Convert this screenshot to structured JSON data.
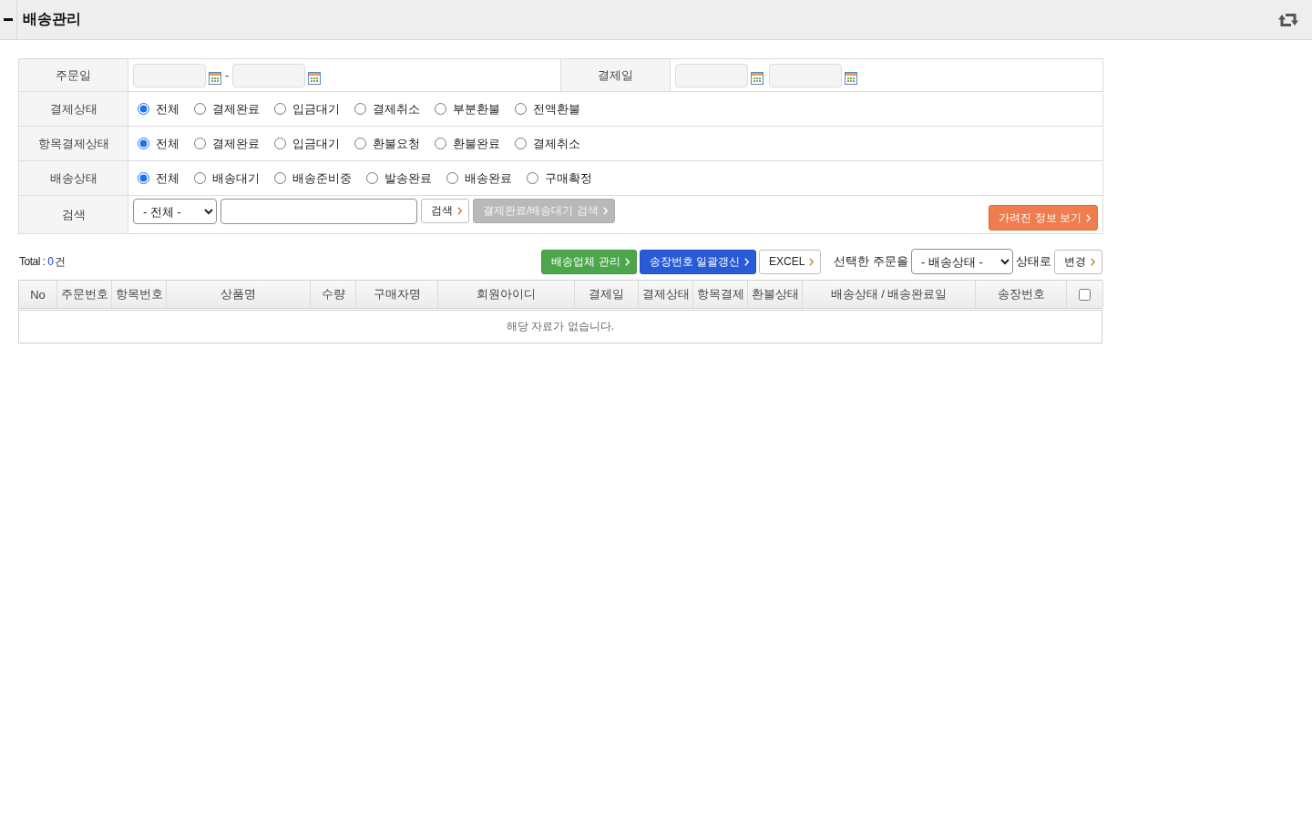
{
  "header": {
    "title": "배송관리"
  },
  "filters": {
    "order_date": {
      "label": "주문일",
      "separator": "-"
    },
    "payment_date": {
      "label": "결제일"
    },
    "radio_groups": [
      {
        "label": "결제상태",
        "options": [
          {
            "label": "전체",
            "selected": true
          },
          {
            "label": "결제완료",
            "selected": false
          },
          {
            "label": "입금대기",
            "selected": false
          },
          {
            "label": "결제취소",
            "selected": false
          },
          {
            "label": "부분환불",
            "selected": false
          },
          {
            "label": "전액환불",
            "selected": false
          }
        ]
      },
      {
        "label": "항목결제상태",
        "options": [
          {
            "label": "전체",
            "selected": true
          },
          {
            "label": "결제완료",
            "selected": false
          },
          {
            "label": "입금대기",
            "selected": false
          },
          {
            "label": "환불요청",
            "selected": false
          },
          {
            "label": "환불완료",
            "selected": false
          },
          {
            "label": "결제취소",
            "selected": false
          }
        ]
      },
      {
        "label": "배송상태",
        "options": [
          {
            "label": "전체",
            "selected": true
          },
          {
            "label": "배송대기",
            "selected": false
          },
          {
            "label": "배송준비중",
            "selected": false
          },
          {
            "label": "발송완료",
            "selected": false
          },
          {
            "label": "배송완료",
            "selected": false
          },
          {
            "label": "구매확정",
            "selected": false
          }
        ]
      }
    ],
    "search": {
      "label": "검색",
      "select_value": "- 전체 -",
      "button": "검색",
      "quick_search_button": "결제완료/배송대기 검색",
      "hidden_info_button": "가려진 정보 보기"
    }
  },
  "summary": {
    "label": "Total :",
    "count": "0",
    "unit": "건"
  },
  "actions": {
    "buttons": [
      {
        "label": "배송업체 관리",
        "kind": "green"
      },
      {
        "label": "송장번호 일괄갱신",
        "kind": "blue"
      },
      {
        "label": "EXCEL",
        "kind": "plain"
      }
    ],
    "bulk_change": {
      "prefix": "선택한 주문을",
      "select_value": "- 배송상태 -",
      "suffix": "상태로",
      "button": "변경"
    }
  },
  "table": {
    "columns": [
      {
        "kind": "text",
        "label": "No"
      },
      {
        "kind": "text",
        "label": "주문번호"
      },
      {
        "kind": "text",
        "label": "항목번호"
      },
      {
        "kind": "text",
        "label": "상품명"
      },
      {
        "kind": "text",
        "label": "수량"
      },
      {
        "kind": "text",
        "label": "구매자명"
      },
      {
        "kind": "text",
        "label": "회원아이디"
      },
      {
        "kind": "text",
        "label": "결제일"
      },
      {
        "kind": "text",
        "label": "결제상태"
      },
      {
        "kind": "text",
        "label": "항목결제"
      },
      {
        "kind": "text",
        "label": "환불상태"
      },
      {
        "kind": "text",
        "label": "배송상태 / 배송완료일"
      },
      {
        "kind": "text",
        "label": "송장번호"
      },
      {
        "kind": "checkbox",
        "checked": false
      }
    ],
    "empty_message": "해당 자료가 없습니다."
  }
}
